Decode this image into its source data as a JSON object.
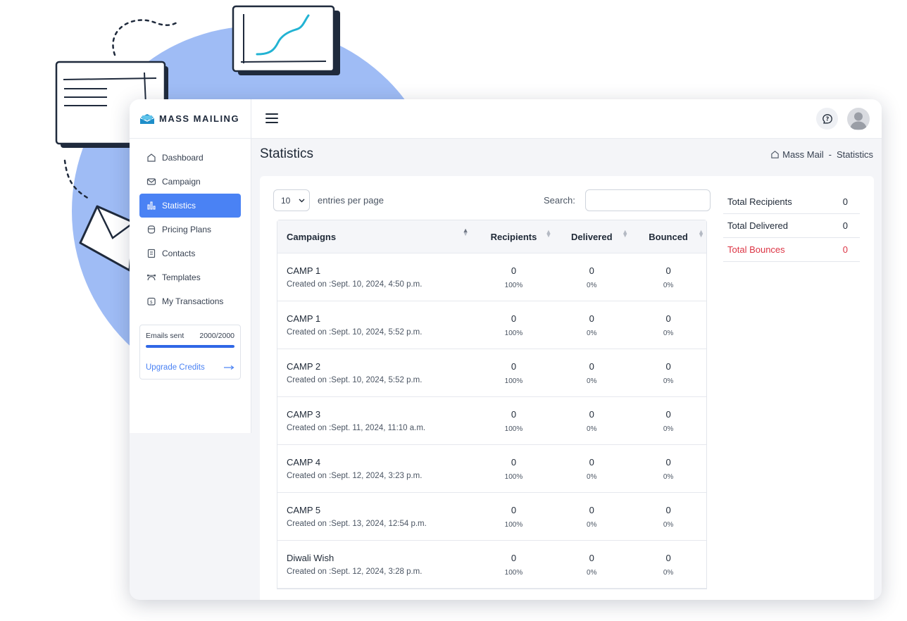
{
  "brand": {
    "name": "MASS MAILING"
  },
  "sidebar": {
    "items": [
      {
        "label": "Dashboard",
        "icon": "home-icon",
        "active": false
      },
      {
        "label": "Campaign",
        "icon": "mail-icon",
        "active": false
      },
      {
        "label": "Statistics",
        "icon": "bar-chart-icon",
        "active": true
      },
      {
        "label": "Pricing Plans",
        "icon": "tag-icon",
        "active": false
      },
      {
        "label": "Contacts",
        "icon": "contacts-icon",
        "active": false
      },
      {
        "label": "Templates",
        "icon": "bezier-icon",
        "active": false
      },
      {
        "label": "My Transactions",
        "icon": "wallet-icon",
        "active": false
      }
    ],
    "credits": {
      "label": "Emails sent",
      "value": "2000/2000",
      "progress": 1.0,
      "upgrade_label": "Upgrade Credits"
    }
  },
  "header": {
    "help_icon": "help-icon",
    "avatar_icon": "user-avatar-icon"
  },
  "page": {
    "title": "Statistics",
    "breadcrumb": {
      "root": "Mass Mail",
      "separator": "-",
      "current": "Statistics"
    }
  },
  "table_controls": {
    "entries_value": "10",
    "entries_label": "entries per page",
    "search_label": "Search:",
    "search_value": ""
  },
  "table": {
    "columns": [
      "Campaigns",
      "Recipients",
      "Delivered",
      "Bounced"
    ],
    "rows": [
      {
        "name": "CAMP 1",
        "created": "Created on :Sept. 10, 2024, 4:50 p.m.",
        "recipients": "0",
        "recipients_pct": "100%",
        "delivered": "0",
        "delivered_pct": "0%",
        "bounced": "0",
        "bounced_pct": "0%"
      },
      {
        "name": "CAMP 1",
        "created": "Created on :Sept. 10, 2024, 5:52 p.m.",
        "recipients": "0",
        "recipients_pct": "100%",
        "delivered": "0",
        "delivered_pct": "0%",
        "bounced": "0",
        "bounced_pct": "0%"
      },
      {
        "name": "CAMP 2",
        "created": "Created on :Sept. 10, 2024, 5:52 p.m.",
        "recipients": "0",
        "recipients_pct": "100%",
        "delivered": "0",
        "delivered_pct": "0%",
        "bounced": "0",
        "bounced_pct": "0%"
      },
      {
        "name": "CAMP 3",
        "created": "Created on :Sept. 11, 2024, 11:10 a.m.",
        "recipients": "0",
        "recipients_pct": "100%",
        "delivered": "0",
        "delivered_pct": "0%",
        "bounced": "0",
        "bounced_pct": "0%"
      },
      {
        "name": "CAMP 4",
        "created": "Created on :Sept. 12, 2024, 3:23 p.m.",
        "recipients": "0",
        "recipients_pct": "100%",
        "delivered": "0",
        "delivered_pct": "0%",
        "bounced": "0",
        "bounced_pct": "0%"
      },
      {
        "name": "CAMP 5",
        "created": "Created on :Sept. 13, 2024, 12:54 p.m.",
        "recipients": "0",
        "recipients_pct": "100%",
        "delivered": "0",
        "delivered_pct": "0%",
        "bounced": "0",
        "bounced_pct": "0%"
      },
      {
        "name": "Diwali Wish",
        "created": "Created on :Sept. 12, 2024, 3:28 p.m.",
        "recipients": "0",
        "recipients_pct": "100%",
        "delivered": "0",
        "delivered_pct": "0%",
        "bounced": "0",
        "bounced_pct": "0%"
      }
    ]
  },
  "summary": {
    "items": [
      {
        "label": "Total Recipients",
        "value": "0"
      },
      {
        "label": "Total Delivered",
        "value": "0"
      },
      {
        "label": "Total Bounces",
        "value": "0"
      }
    ]
  },
  "colors": {
    "accent": "#4a82f4",
    "danger": "#dc3545",
    "backdrop_circle": "#9fbcf5"
  }
}
